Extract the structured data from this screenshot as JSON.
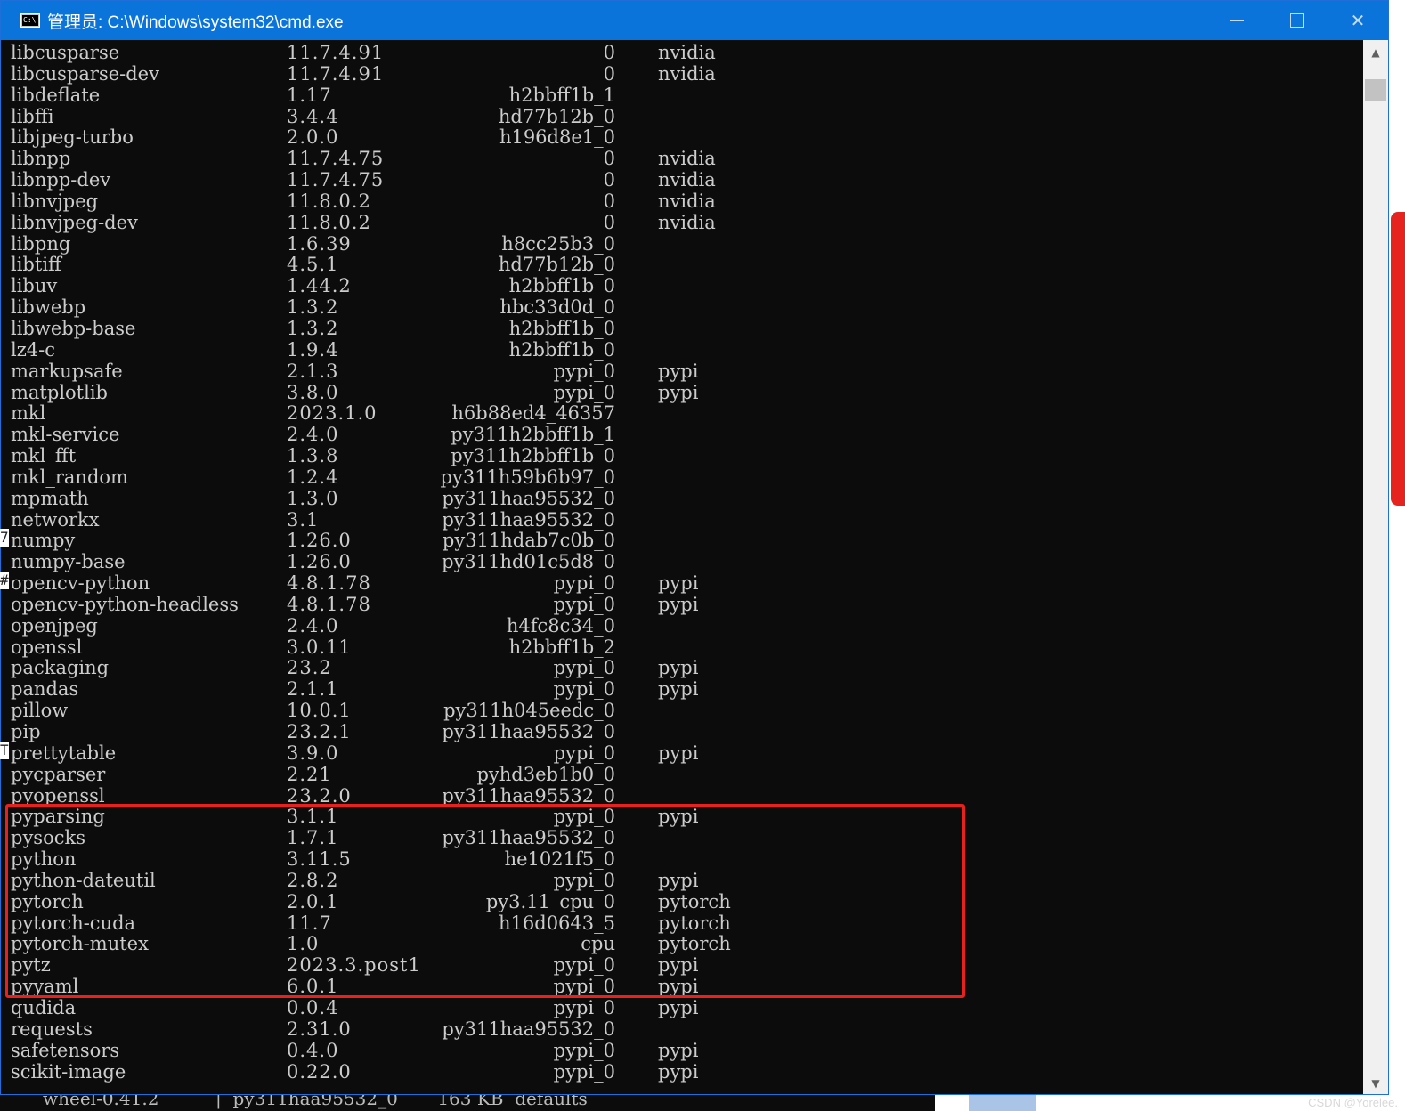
{
  "window": {
    "title": "管理员: C:\\Windows\\system32\\cmd.exe",
    "app_icon_text": "C:\\",
    "minimize_label": "—",
    "maximize_label": "☐",
    "close_label": "✕"
  },
  "packages": [
    {
      "name": "libcusparse",
      "version": "11.7.4.91",
      "build": "0",
      "channel": "nvidia"
    },
    {
      "name": "libcusparse-dev",
      "version": "11.7.4.91",
      "build": "0",
      "channel": "nvidia"
    },
    {
      "name": "libdeflate",
      "version": "1.17",
      "build": "h2bbff1b_1",
      "channel": ""
    },
    {
      "name": "libffi",
      "version": "3.4.4",
      "build": "hd77b12b_0",
      "channel": ""
    },
    {
      "name": "libjpeg-turbo",
      "version": "2.0.0",
      "build": "h196d8e1_0",
      "channel": ""
    },
    {
      "name": "libnpp",
      "version": "11.7.4.75",
      "build": "0",
      "channel": "nvidia"
    },
    {
      "name": "libnpp-dev",
      "version": "11.7.4.75",
      "build": "0",
      "channel": "nvidia"
    },
    {
      "name": "libnvjpeg",
      "version": "11.8.0.2",
      "build": "0",
      "channel": "nvidia"
    },
    {
      "name": "libnvjpeg-dev",
      "version": "11.8.0.2",
      "build": "0",
      "channel": "nvidia"
    },
    {
      "name": "libpng",
      "version": "1.6.39",
      "build": "h8cc25b3_0",
      "channel": ""
    },
    {
      "name": "libtiff",
      "version": "4.5.1",
      "build": "hd77b12b_0",
      "channel": ""
    },
    {
      "name": "libuv",
      "version": "1.44.2",
      "build": "h2bbff1b_0",
      "channel": ""
    },
    {
      "name": "libwebp",
      "version": "1.3.2",
      "build": "hbc33d0d_0",
      "channel": ""
    },
    {
      "name": "libwebp-base",
      "version": "1.3.2",
      "build": "h2bbff1b_0",
      "channel": ""
    },
    {
      "name": "lz4-c",
      "version": "1.9.4",
      "build": "h2bbff1b_0",
      "channel": ""
    },
    {
      "name": "markupsafe",
      "version": "2.1.3",
      "build": "pypi_0",
      "channel": "pypi"
    },
    {
      "name": "matplotlib",
      "version": "3.8.0",
      "build": "pypi_0",
      "channel": "pypi"
    },
    {
      "name": "mkl",
      "version": "2023.1.0",
      "build": "h6b88ed4_46357",
      "channel": ""
    },
    {
      "name": "mkl-service",
      "version": "2.4.0",
      "build": "py311h2bbff1b_1",
      "channel": ""
    },
    {
      "name": "mkl_fft",
      "version": "1.3.8",
      "build": "py311h2bbff1b_0",
      "channel": ""
    },
    {
      "name": "mkl_random",
      "version": "1.2.4",
      "build": "py311h59b6b97_0",
      "channel": ""
    },
    {
      "name": "mpmath",
      "version": "1.3.0",
      "build": "py311haa95532_0",
      "channel": ""
    },
    {
      "name": "networkx",
      "version": "3.1",
      "build": "py311haa95532_0",
      "channel": ""
    },
    {
      "name": "numpy",
      "version": "1.26.0",
      "build": "py311hdab7c0b_0",
      "channel": ""
    },
    {
      "name": "numpy-base",
      "version": "1.26.0",
      "build": "py311hd01c5d8_0",
      "channel": ""
    },
    {
      "name": "opencv-python",
      "version": "4.8.1.78",
      "build": "pypi_0",
      "channel": "pypi"
    },
    {
      "name": "opencv-python-headless",
      "version": "4.8.1.78",
      "build": "pypi_0",
      "channel": "pypi"
    },
    {
      "name": "openjpeg",
      "version": "2.4.0",
      "build": "h4fc8c34_0",
      "channel": ""
    },
    {
      "name": "openssl",
      "version": "3.0.11",
      "build": "h2bbff1b_2",
      "channel": ""
    },
    {
      "name": "packaging",
      "version": "23.2",
      "build": "pypi_0",
      "channel": "pypi"
    },
    {
      "name": "pandas",
      "version": "2.1.1",
      "build": "pypi_0",
      "channel": "pypi"
    },
    {
      "name": "pillow",
      "version": "10.0.1",
      "build": "py311h045eedc_0",
      "channel": ""
    },
    {
      "name": "pip",
      "version": "23.2.1",
      "build": "py311haa95532_0",
      "channel": ""
    },
    {
      "name": "prettytable",
      "version": "3.9.0",
      "build": "pypi_0",
      "channel": "pypi"
    },
    {
      "name": "pycparser",
      "version": "2.21",
      "build": "pyhd3eb1b0_0",
      "channel": ""
    },
    {
      "name": "pyopenssl",
      "version": "23.2.0",
      "build": "py311haa95532_0",
      "channel": ""
    },
    {
      "name": "pyparsing",
      "version": "3.1.1",
      "build": "pypi_0",
      "channel": "pypi"
    },
    {
      "name": "pysocks",
      "version": "1.7.1",
      "build": "py311haa95532_0",
      "channel": ""
    },
    {
      "name": "python",
      "version": "3.11.5",
      "build": "he1021f5_0",
      "channel": ""
    },
    {
      "name": "python-dateutil",
      "version": "2.8.2",
      "build": "pypi_0",
      "channel": "pypi"
    },
    {
      "name": "pytorch",
      "version": "2.0.1",
      "build": "py3.11_cpu_0",
      "channel": "pytorch"
    },
    {
      "name": "pytorch-cuda",
      "version": "11.7",
      "build": "h16d0643_5",
      "channel": "pytorch"
    },
    {
      "name": "pytorch-mutex",
      "version": "1.0",
      "build": "cpu",
      "channel": "pytorch"
    },
    {
      "name": "pytz",
      "version": "2023.3.post1",
      "build": "pypi_0",
      "channel": "pypi"
    },
    {
      "name": "pyyaml",
      "version": "6.0.1",
      "build": "pypi_0",
      "channel": "pypi"
    },
    {
      "name": "qudida",
      "version": "0.0.4",
      "build": "pypi_0",
      "channel": "pypi"
    },
    {
      "name": "requests",
      "version": "2.31.0",
      "build": "py311haa95532_0",
      "channel": ""
    },
    {
      "name": "safetensors",
      "version": "0.4.0",
      "build": "pypi_0",
      "channel": "pypi"
    },
    {
      "name": "scikit-image",
      "version": "0.22.0",
      "build": "pypi_0",
      "channel": "pypi"
    }
  ],
  "background": {
    "bottom_text": "wheel-0.41.2          |  py311haa95532_0       163 KB  defaults",
    "left_marks": [
      "7",
      "#",
      "T"
    ]
  },
  "watermark": "CSDN @Yorelee.",
  "colors": {
    "titlebar": "#0a74da",
    "console_bg": "#0c0c0c",
    "console_text": "#cccccc",
    "highlight_box": "#e8201e"
  }
}
